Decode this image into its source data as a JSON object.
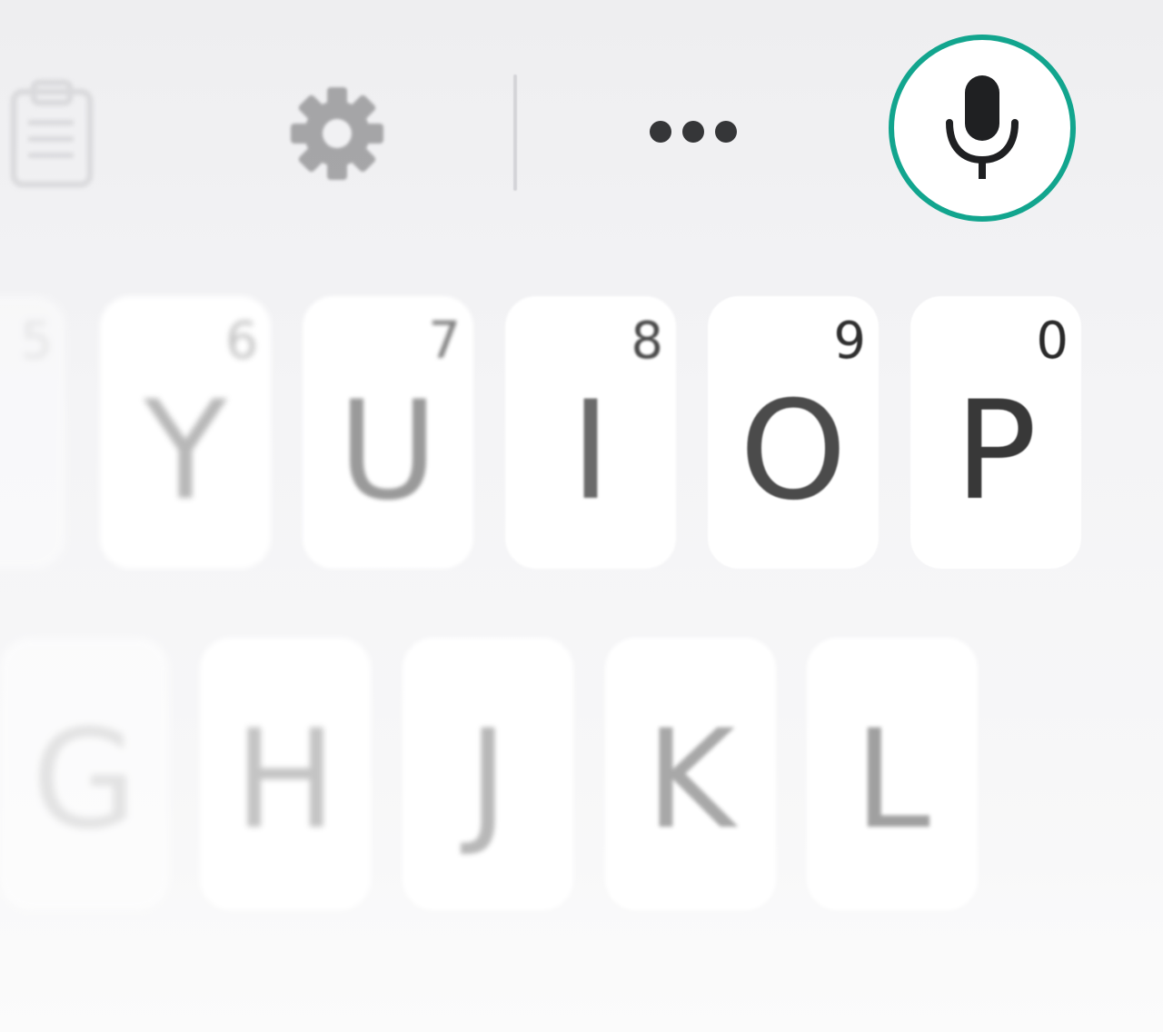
{
  "toolbar": {
    "clipboard_icon": "clipboard-icon",
    "settings_icon": "gear-icon",
    "more_icon": "more-horizontal-icon",
    "mic_icon": "microphone-icon",
    "accent_color": "#12a58e"
  },
  "keyboard": {
    "row1": [
      {
        "letter": "",
        "number": "5",
        "color": "#d2d2d2"
      },
      {
        "letter": "Y",
        "number": "6",
        "color": "#b8b8b8"
      },
      {
        "letter": "U",
        "number": "7",
        "color": "#9a9a9a"
      },
      {
        "letter": "I",
        "number": "8",
        "color": "#6a6a6a"
      },
      {
        "letter": "O",
        "number": "9",
        "color": "#4b4b4b"
      },
      {
        "letter": "P",
        "number": "0",
        "color": "#383838"
      }
    ],
    "row2": [
      {
        "letter": "G",
        "color": "#d6d6d6"
      },
      {
        "letter": "H",
        "color": "#c4c4c4"
      },
      {
        "letter": "J",
        "color": "#b8b8b8"
      },
      {
        "letter": "K",
        "color": "#a8a8a8"
      },
      {
        "letter": "L",
        "color": "#a0a0a0"
      }
    ]
  }
}
